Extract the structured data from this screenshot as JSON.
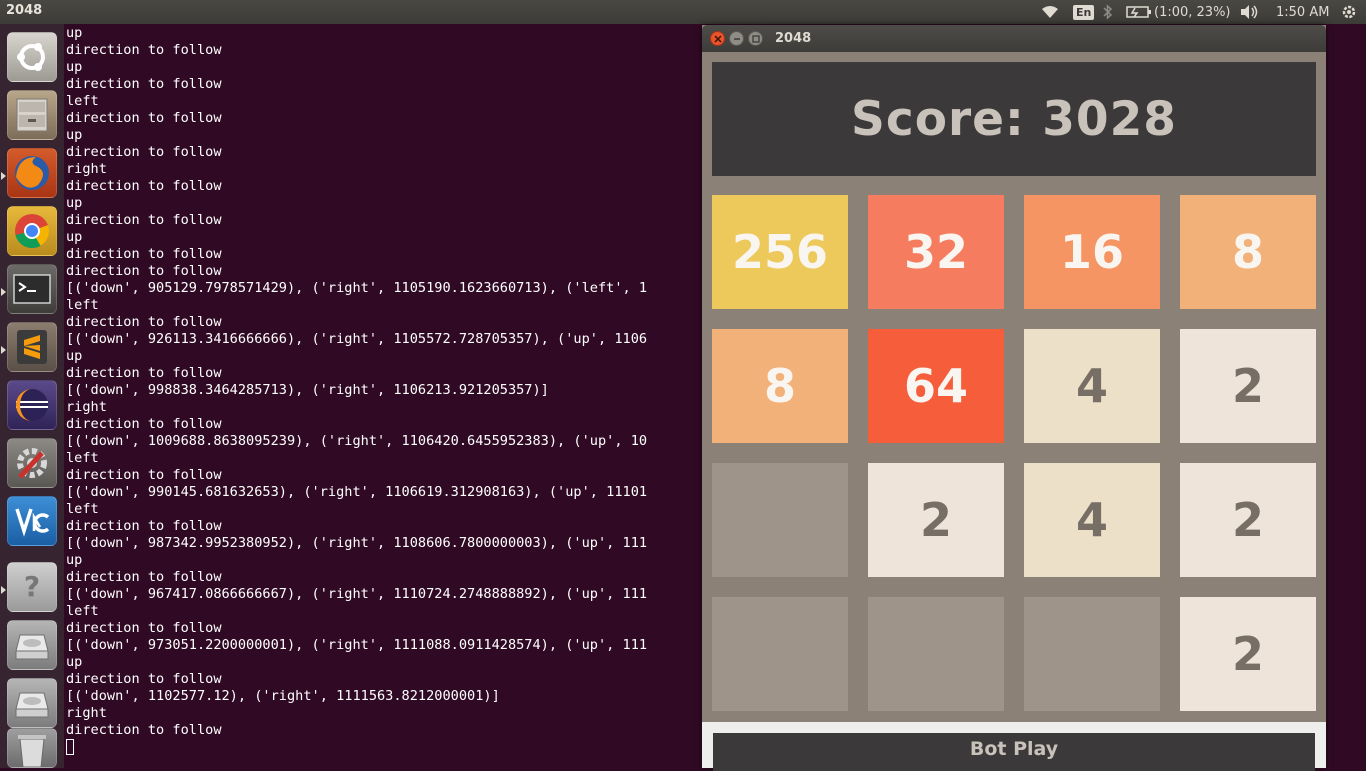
{
  "top_panel": {
    "app_title": "2048",
    "keyboard_layout": "En",
    "battery_text": "(1:00, 23%)",
    "clock": "1:50 AM",
    "icons": [
      "wifi-icon",
      "bluetooth-icon",
      "battery-icon",
      "volume-icon",
      "power-gear-icon"
    ]
  },
  "launcher": {
    "items": [
      {
        "name": "ubuntu-dash",
        "icon": "ubuntu-logo-icon",
        "running": false
      },
      {
        "name": "files",
        "icon": "file-cabinet-icon",
        "running": false
      },
      {
        "name": "firefox",
        "icon": "firefox-icon",
        "running": true
      },
      {
        "name": "chrome",
        "icon": "chrome-icon",
        "running": false
      },
      {
        "name": "terminal",
        "icon": "terminal-icon",
        "running": true
      },
      {
        "name": "sublime-text",
        "icon": "sublime-text-icon",
        "running": true
      },
      {
        "name": "eclipse",
        "icon": "eclipse-icon",
        "running": false
      },
      {
        "name": "system-settings",
        "icon": "settings-wrench-icon",
        "running": false
      },
      {
        "name": "vnc-viewer",
        "icon": "vnc-icon",
        "running": false
      },
      {
        "name": "help",
        "icon": "question-mark-icon",
        "running": true
      },
      {
        "name": "drive-1",
        "icon": "hard-drive-icon",
        "running": false
      },
      {
        "name": "drive-2",
        "icon": "hard-drive-icon",
        "running": false
      },
      {
        "name": "trash",
        "icon": "trash-icon",
        "running": false
      }
    ]
  },
  "terminal": {
    "lines": [
      "up",
      "direction to follow",
      "up",
      "direction to follow",
      "left",
      "direction to follow",
      "up",
      "direction to follow",
      "right",
      "direction to follow",
      "up",
      "direction to follow",
      "up",
      "direction to follow",
      "direction to follow",
      "[('down', 905129.7978571429), ('right', 1105190.1623660713), ('left', 1",
      "left",
      "direction to follow",
      "[('down', 926113.3416666666), ('right', 1105572.728705357), ('up', 1106",
      "up",
      "direction to follow",
      "[('down', 998838.3464285713), ('right', 1106213.921205357)]",
      "right",
      "direction to follow",
      "[('down', 1009688.8638095239), ('right', 1106420.6455952383), ('up', 10",
      "left",
      "direction to follow",
      "[('down', 990145.681632653), ('right', 1106619.312908163), ('up', 11101",
      "left",
      "direction to follow",
      "[('down', 987342.9952380952), ('right', 1108606.7800000003), ('up', 111",
      "up",
      "direction to follow",
      "[('down', 967417.0866666667), ('right', 1110724.2748888892), ('up', 111",
      "left",
      "direction to follow",
      "[('down', 973051.2200000001), ('right', 1111088.0911428574), ('up', 111",
      "up",
      "direction to follow",
      "[('down', 1102577.12), ('right', 1111563.8212000001)]",
      "right",
      "direction to follow"
    ]
  },
  "game": {
    "window_title": "2048",
    "score_text": "Score: 3028",
    "bot_button_label": "Bot Play",
    "tiles": [
      {
        "value": "256",
        "bg": "#edc85a",
        "fg": "#f9f6f2"
      },
      {
        "value": "32",
        "bg": "#f67c5f",
        "fg": "#f9f6f2"
      },
      {
        "value": "16",
        "bg": "#f59563",
        "fg": "#f9f6f2"
      },
      {
        "value": "8",
        "bg": "#f2b179",
        "fg": "#f9f6f2"
      },
      {
        "value": "8",
        "bg": "#f2b179",
        "fg": "#f9f6f2"
      },
      {
        "value": "64",
        "bg": "#f65e3b",
        "fg": "#f9f6f2"
      },
      {
        "value": "4",
        "bg": "#ede0c8",
        "fg": "#776e65"
      },
      {
        "value": "2",
        "bg": "#eee4da",
        "fg": "#776e65"
      },
      {
        "value": "",
        "bg": "#9e948a",
        "fg": "#776e65"
      },
      {
        "value": "2",
        "bg": "#eee4da",
        "fg": "#776e65"
      },
      {
        "value": "4",
        "bg": "#ede0c8",
        "fg": "#776e65"
      },
      {
        "value": "2",
        "bg": "#eee4da",
        "fg": "#776e65"
      },
      {
        "value": "",
        "bg": "#9e948a",
        "fg": "#776e65"
      },
      {
        "value": "",
        "bg": "#9e948a",
        "fg": "#776e65"
      },
      {
        "value": "",
        "bg": "#9e948a",
        "fg": "#776e65"
      },
      {
        "value": "2",
        "bg": "#eee4da",
        "fg": "#776e65"
      }
    ],
    "window_controls": [
      {
        "name": "close-button",
        "icon": "close-icon",
        "color": "#e9542d"
      },
      {
        "name": "minimize-button",
        "icon": "minimize-icon",
        "color": "#8f8c86"
      },
      {
        "name": "maximize-button",
        "icon": "maximize-icon",
        "color": "#8f8c86"
      }
    ]
  }
}
